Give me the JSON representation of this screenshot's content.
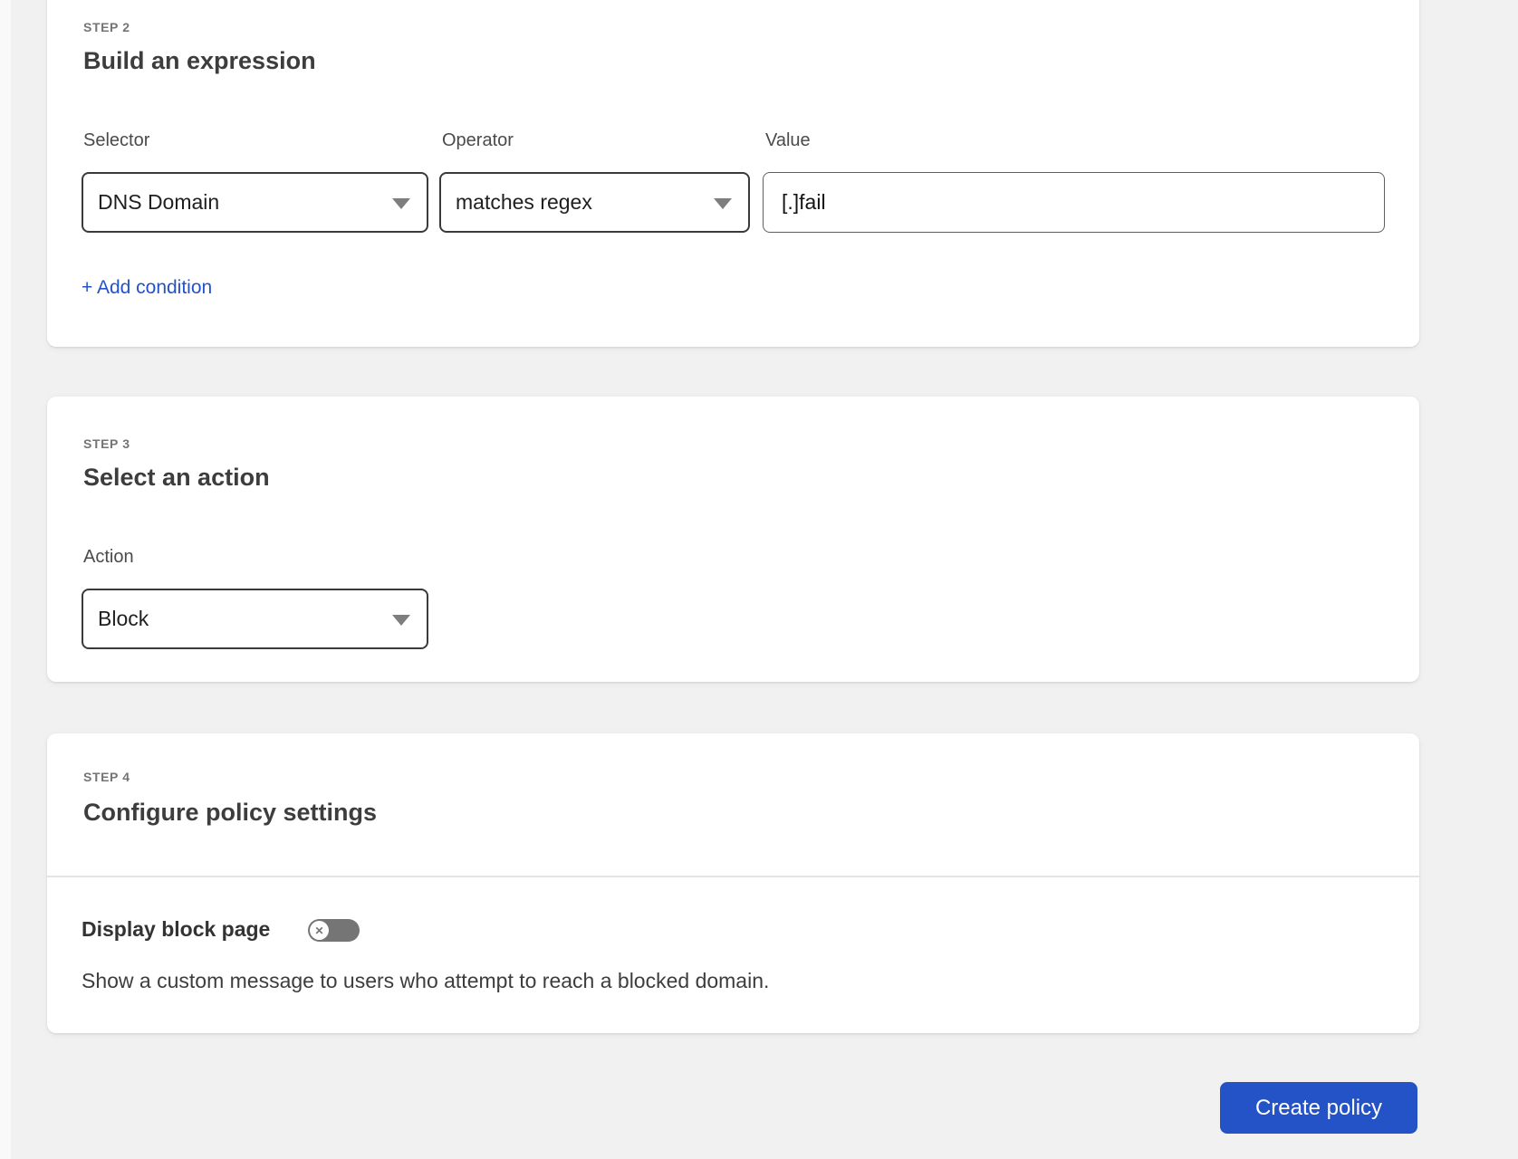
{
  "colors": {
    "accent_blue": "#2452c7",
    "toggle_off_gray": "#757575",
    "page_background": "#f1f1f1"
  },
  "step2": {
    "label": "STEP 2",
    "title": "Build an expression",
    "fields": {
      "selector": {
        "label": "Selector",
        "value": "DNS Domain"
      },
      "operator": {
        "label": "Operator",
        "value": "matches regex"
      },
      "value": {
        "label": "Value",
        "value": "[.]fail"
      }
    },
    "add_condition_label": "+ Add condition"
  },
  "step3": {
    "label": "STEP 3",
    "title": "Select an action",
    "action": {
      "label": "Action",
      "value": "Block"
    }
  },
  "step4": {
    "label": "STEP 4",
    "title": "Configure policy settings",
    "block_page_setting": {
      "label": "Display block page",
      "state": "off",
      "toggle_glyph": "✕",
      "description": "Show a custom message to users who attempt to reach a blocked domain."
    }
  },
  "footer": {
    "create_button_label": "Create policy"
  }
}
